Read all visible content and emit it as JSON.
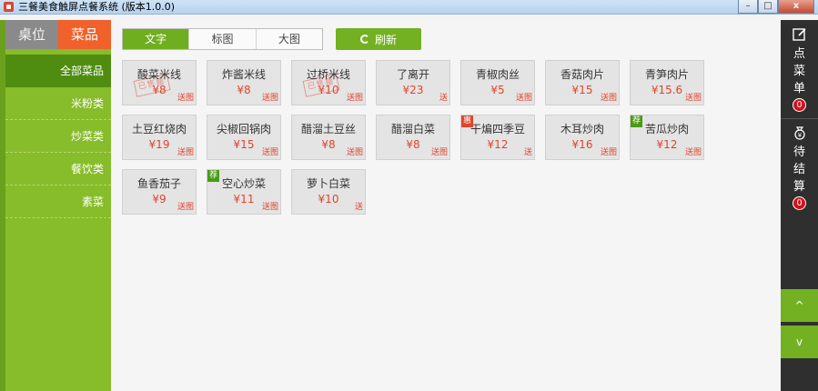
{
  "window": {
    "title": "三餐美食触屏点餐系统 (版本1.0.0)",
    "buttons": {
      "minimize": "–",
      "maximize": "□",
      "close": "x"
    }
  },
  "nav": {
    "top_tabs": [
      "桌位",
      "菜品"
    ],
    "active_top_tab": 1,
    "categories": [
      "全部菜品",
      "米粉类",
      "炒菜类",
      "餐饮类",
      "素菜"
    ],
    "active_category": 0
  },
  "toolbar": {
    "view_tabs": [
      "文字",
      "标图",
      "大图"
    ],
    "active_view": 0,
    "refresh_label": "刷新"
  },
  "dishes": [
    {
      "name": "酸菜米线",
      "price": "¥8",
      "note": "送图",
      "stamp": "已售罄"
    },
    {
      "name": "炸酱米线",
      "price": "¥8",
      "note": "送图"
    },
    {
      "name": "过桥米线",
      "price": "¥10",
      "note": "送图",
      "stamp": "已售罄"
    },
    {
      "name": "了离开",
      "price": "¥23",
      "note": "送"
    },
    {
      "name": "青椒肉丝",
      "price": "¥5",
      "note": "送图"
    },
    {
      "name": "香菇肉片",
      "price": "¥15",
      "note": "送图"
    },
    {
      "name": "青笋肉片",
      "price": "¥15.6",
      "note": "送图"
    },
    {
      "name": "土豆红烧肉",
      "price": "¥19",
      "note": "送图"
    },
    {
      "name": "尖椒回锅肉",
      "price": "¥15",
      "note": "送图"
    },
    {
      "name": "醋溜土豆丝",
      "price": "¥8",
      "note": "送图"
    },
    {
      "name": "醋溜白菜",
      "price": "¥8",
      "note": "送图"
    },
    {
      "name": "干煸四季豆",
      "price": "¥12",
      "note": "送",
      "badge": "惠",
      "badge_type": "promo"
    },
    {
      "name": "木耳炒肉",
      "price": "¥16",
      "note": "送图"
    },
    {
      "name": "苦瓜炒肉",
      "price": "¥12",
      "note": "送图",
      "badge": "荐",
      "badge_type": "rec"
    },
    {
      "name": "鱼香茄子",
      "price": "¥9",
      "note": "送图"
    },
    {
      "name": "空心炒菜",
      "price": "¥11",
      "note": "送图",
      "badge": "荐",
      "badge_type": "rec"
    },
    {
      "name": "萝卜白菜",
      "price": "¥10",
      "note": "送"
    }
  ],
  "right_panel": {
    "order_label": [
      "点",
      "菜",
      "单"
    ],
    "order_count": "0",
    "pending_label": [
      "待",
      "结",
      "算"
    ],
    "pending_count": "0",
    "up_label": "^",
    "down_label": "v"
  },
  "colors": {
    "accent_green": "#73b122",
    "orange": "#f0612b",
    "price_red": "#e0452b",
    "dark_panel": "#2f2f2f"
  }
}
